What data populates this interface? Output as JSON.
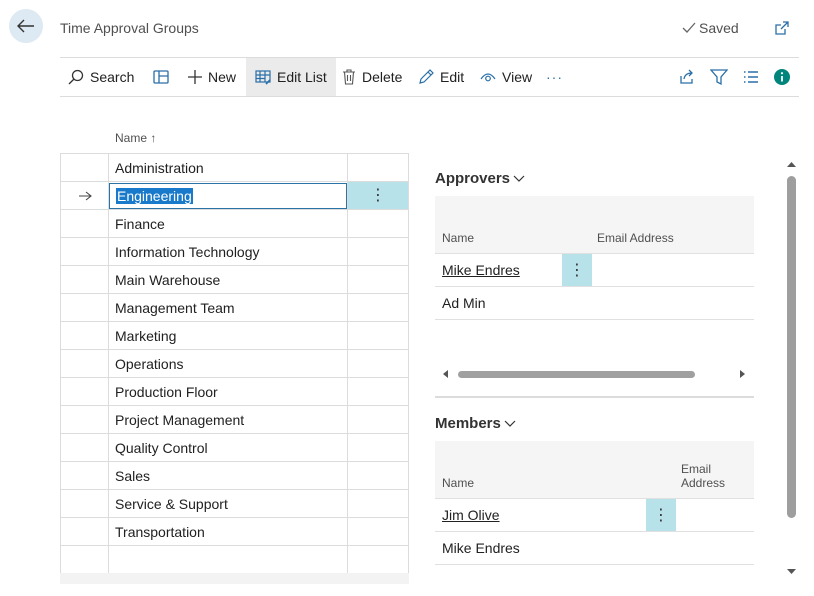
{
  "header": {
    "title": "Time Approval Groups",
    "saved_label": "Saved"
  },
  "actions": {
    "search": "Search",
    "new": "New",
    "edit_list": "Edit List",
    "delete": "Delete",
    "edit": "Edit",
    "view": "View",
    "more": "···"
  },
  "list": {
    "column_header": "Name ↑",
    "selected_index": 1,
    "rows": [
      "Administration",
      "Engineering",
      "Finance",
      "Information Technology",
      "Main Warehouse",
      "Management Team",
      "Marketing",
      "Operations",
      "Production Floor",
      "Project Management",
      "Quality Control",
      "Sales",
      "Service & Support",
      "Transportation"
    ]
  },
  "approvers": {
    "title": "Approvers",
    "col_name": "Name",
    "col_email": "Email Address",
    "rows": [
      "Mike Endres",
      "Ad Min"
    ]
  },
  "members": {
    "title": "Members",
    "col_name": "Name",
    "col_email": "Email Address",
    "rows": [
      "Jim Olive",
      "Mike Endres"
    ]
  },
  "colors": {
    "accent": "#1979ca",
    "selected_cell": "#b7e2ea",
    "back_button": "#dde9f3",
    "info_icon": "#00857c"
  },
  "icons": {
    "back": "arrow-left-icon",
    "saved": "check-icon",
    "popout": "popout-icon",
    "search": "search-icon",
    "layout": "layout-icon",
    "new": "plus-icon",
    "edit_list": "table-edit-icon",
    "delete": "trash-icon",
    "edit": "pencil-icon",
    "view": "eye-icon",
    "share": "share-icon",
    "filter": "filter-icon",
    "list_view": "list-icon",
    "info": "info-icon"
  }
}
